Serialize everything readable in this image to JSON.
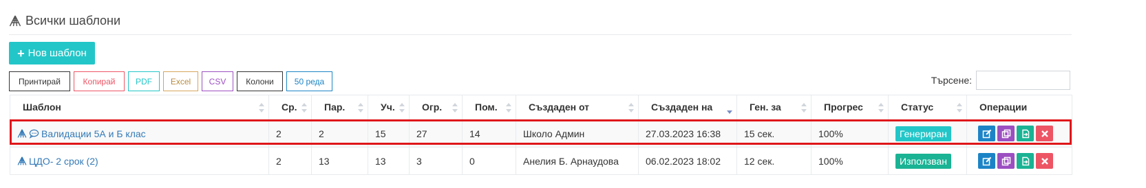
{
  "page": {
    "title": "Всички шаблони"
  },
  "toolbar": {
    "new_label": "Нов шаблон"
  },
  "export_buttons": {
    "print": "Принтирай",
    "copy": "Копирай",
    "pdf": "PDF",
    "excel": "Excel",
    "csv": "CSV",
    "columns": "Колони",
    "rows": "50 реда"
  },
  "search": {
    "label": "Търсене:",
    "value": "",
    "placeholder": ""
  },
  "table": {
    "columns": [
      "Шаблон",
      "Ср.",
      "Пар.",
      "Уч.",
      "Огр.",
      "Пом.",
      "Създаден от",
      "Създаден на",
      "Ген. за",
      "Прогрес",
      "Статус",
      "Операции"
    ],
    "sorted_column": "Създаден на",
    "rows": [
      {
        "name": "Валидации 5А и Б клас",
        "sr": "2",
        "par": "2",
        "uch": "15",
        "ogr": "27",
        "pom": "14",
        "created_by": "Школо Админ",
        "created_at": "27.03.2023 16:38",
        "gen_for": "15 сек.",
        "progress": "100%",
        "status": "Генериран",
        "has_comment_icon": true
      },
      {
        "name": "ЦДО- 2 срок (2)",
        "sr": "2",
        "par": "13",
        "uch": "13",
        "ogr": "3",
        "pom": "0",
        "created_by": "Анелия Б. Арнаудова",
        "created_at": "06.02.2023 18:02",
        "gen_for": "12 сек.",
        "progress": "100%",
        "status": "Използван",
        "has_comment_icon": false
      }
    ]
  },
  "colors": {
    "accent_cyan": "#23c6c8",
    "primary_blue": "#1c84c6",
    "green": "#1ab394",
    "purple": "#9c4fc1",
    "red": "#ed5565",
    "highlight_red": "#e0161a"
  },
  "icons": {
    "header": "templates-icon",
    "row_template": "templates-icon",
    "row_comment": "comment-icon",
    "edit": "edit-icon",
    "duplicate": "duplicate-icon",
    "export": "export-icon",
    "delete": "delete-icon"
  }
}
